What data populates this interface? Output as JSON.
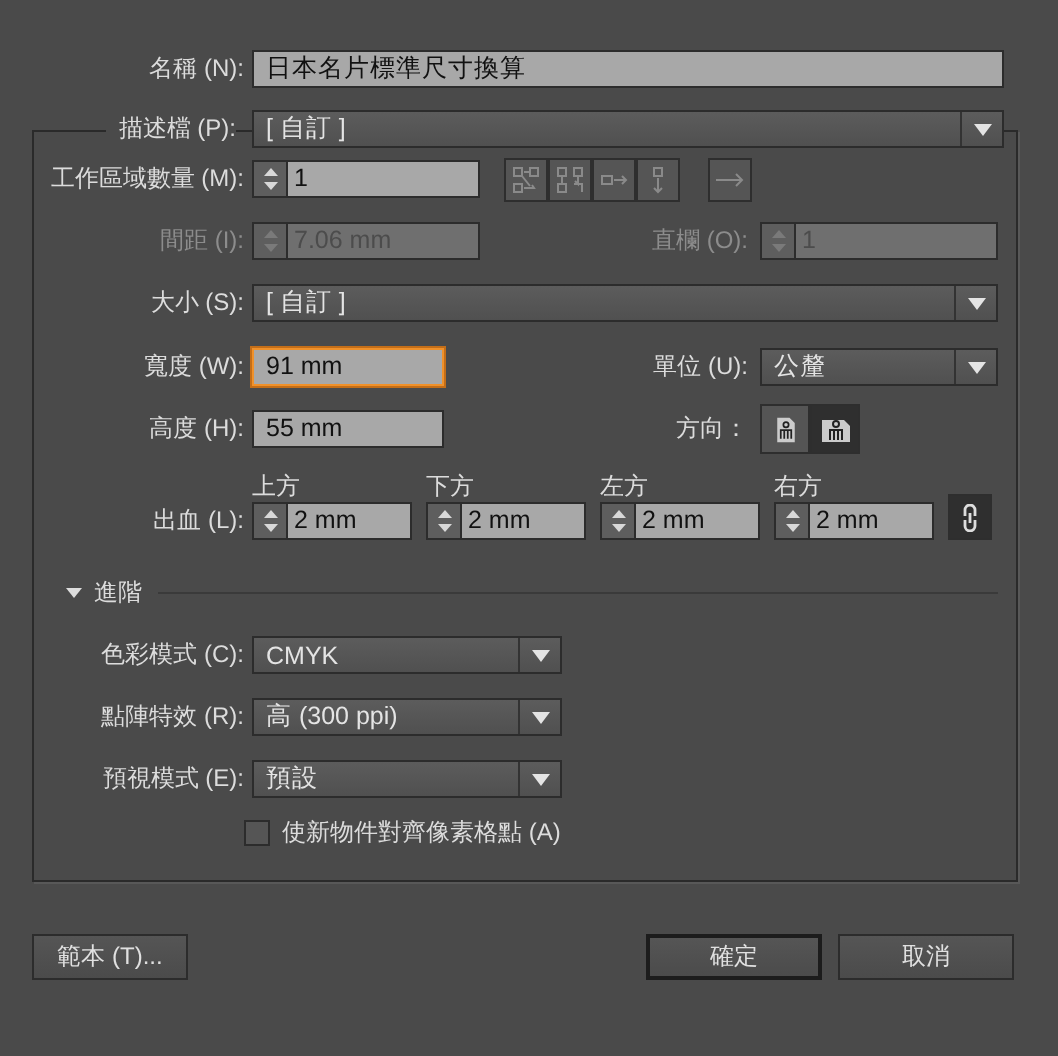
{
  "name": {
    "label": "名稱 (N):",
    "value": "日本名片標準尺寸換算"
  },
  "profile": {
    "label": "描述檔 (P):",
    "value": "[ 自訂 ]"
  },
  "artboards": {
    "label": "工作區域數量 (M):",
    "value": "1"
  },
  "spacing": {
    "label": "間距 (I):",
    "value": "7.06 mm",
    "disabled": true
  },
  "columns": {
    "label": "直欄 (O):",
    "value": "1",
    "disabled": true
  },
  "size": {
    "label": "大小 (S):",
    "value": "[ 自訂 ]"
  },
  "width": {
    "label": "寬度 (W):",
    "value": "91 mm",
    "focused": true
  },
  "units": {
    "label": "單位 (U):",
    "value": "公釐"
  },
  "height": {
    "label": "高度 (H):",
    "value": "55 mm",
    "focused": false
  },
  "orientation": {
    "label": "方向：",
    "options": [
      {
        "kind": "portrait",
        "selected": false
      },
      {
        "kind": "landscape",
        "selected": true
      }
    ]
  },
  "bleed": {
    "label": "出血 (L):",
    "linked": true,
    "sides": [
      {
        "heading": "上方",
        "value": "2 mm"
      },
      {
        "heading": "下方",
        "value": "2 mm"
      },
      {
        "heading": "左方",
        "value": "2 mm"
      },
      {
        "heading": "右方",
        "value": "2 mm"
      }
    ]
  },
  "advanced": {
    "label": "進階",
    "expanded": true,
    "fields": [
      {
        "label": "色彩模式 (C):",
        "value": "CMYK"
      },
      {
        "label": "點陣特效 (R):",
        "value": "高 (300 ppi)"
      },
      {
        "label": "預視模式 (E):",
        "value": "預設"
      }
    ],
    "align_pixel": {
      "label": "使新物件對齊像素格點 (A)",
      "checked": false
    }
  },
  "buttons": [
    {
      "label": "範本 (T)...",
      "kind": "template",
      "default": false
    },
    {
      "label": "確定",
      "kind": "ok",
      "default": true
    },
    {
      "label": "取消",
      "kind": "cancel",
      "default": false
    }
  ]
}
